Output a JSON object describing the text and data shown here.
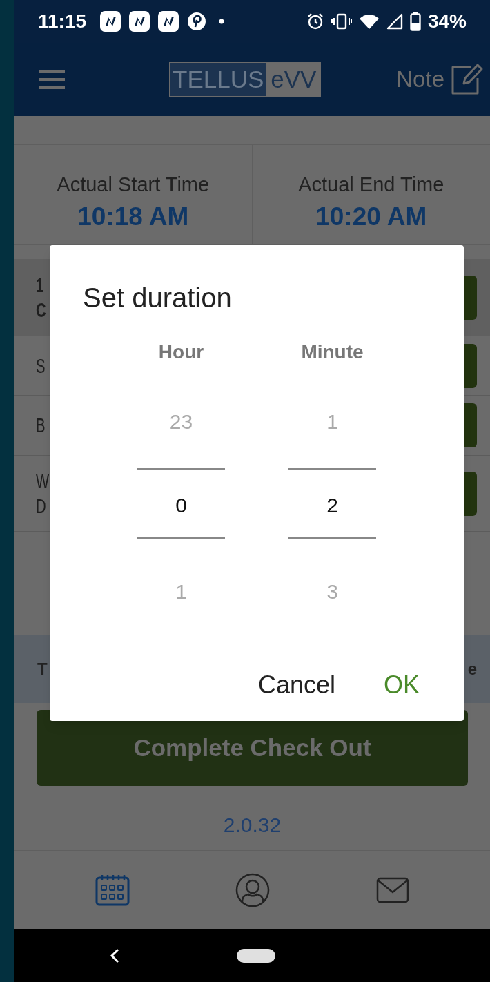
{
  "status_bar": {
    "time": "11:15",
    "battery": "34%"
  },
  "app_bar": {
    "logo_left": "TELLUS",
    "logo_right": "eVV",
    "note": "Note"
  },
  "times": [
    {
      "label": "Actual Start Time",
      "value": "10:18 AM"
    },
    {
      "label": "Actual End Time",
      "value": "10:20 AM"
    }
  ],
  "rows": [
    {
      "lines": [
        "1",
        "C"
      ],
      "bold": true
    },
    {
      "lines": [
        "S"
      ],
      "bold": false
    },
    {
      "lines": [
        "B"
      ],
      "bold": false
    },
    {
      "lines": [
        "W",
        "D"
      ],
      "bold": false
    }
  ],
  "band": {
    "left": "T",
    "right": "e"
  },
  "main_button": "Complete Check Out",
  "version": "2.0.32",
  "bottom_nav": [
    {
      "kind": "calendar",
      "selected": true
    },
    {
      "kind": "profile",
      "selected": false
    },
    {
      "kind": "mail",
      "selected": false
    }
  ],
  "dialog": {
    "title": "Set duration",
    "columns": [
      {
        "label": "Hour",
        "previous": "23",
        "value": "0",
        "next": "1"
      },
      {
        "label": "Minute",
        "previous": "1",
        "value": "2",
        "next": "3"
      }
    ],
    "buttons": [
      {
        "label": "Cancel",
        "kind": "neutral"
      },
      {
        "label": "OK",
        "kind": "positive"
      }
    ]
  }
}
